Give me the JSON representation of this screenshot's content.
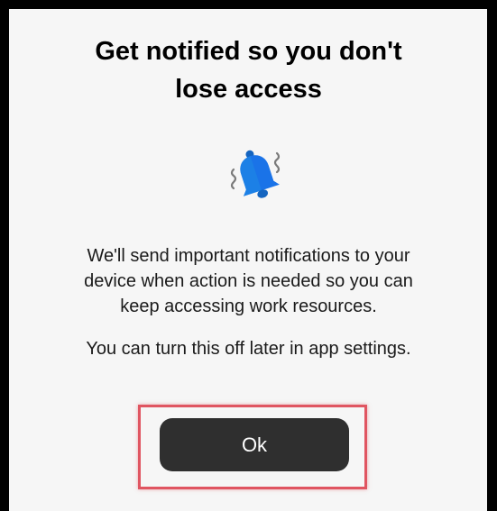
{
  "dialog": {
    "title_line1": "Get notified so you don't",
    "title_line2": "lose access",
    "icon": "bell-notification-icon",
    "body_line1": "We'll send important notifications to your",
    "body_line2": "device when action is needed so you can",
    "body_line3": "keep accessing work resources.",
    "note": "You can turn this off later in app settings.",
    "ok_label": "Ok"
  },
  "colors": {
    "accent": "#1a73e8",
    "button": "#2f2f2f",
    "highlight": "#e05561",
    "background": "#f6f6f6"
  }
}
